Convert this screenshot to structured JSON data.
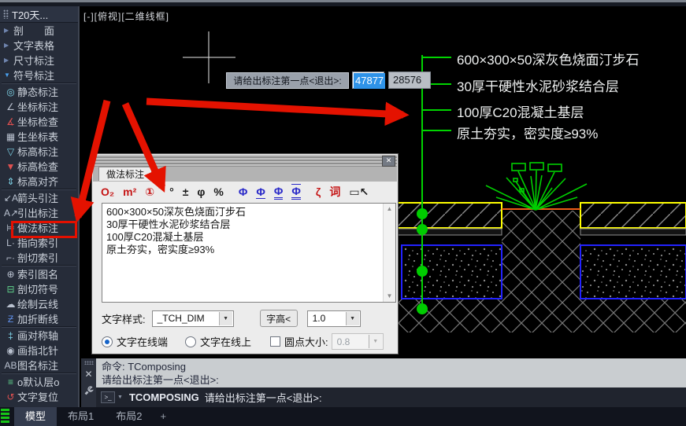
{
  "window": {
    "viewport_label": "[-][俯视][二维线框]"
  },
  "icons": {
    "chevron_right": "▶",
    "chevron_down": "▼",
    "close": "✕",
    "dropdown": "▼",
    "scroll_up": "▲",
    "scroll_down": "▼",
    "prompt": "&gt;_"
  },
  "sidebar": {
    "title": "T20天...",
    "items": [
      {
        "label": "剖　　面"
      },
      {
        "label": "文字表格"
      },
      {
        "label": "尺寸标注"
      },
      {
        "label": "符号标注"
      },
      {
        "label": "静态标注",
        "icon": "◎"
      },
      {
        "label": "坐标标注",
        "icon": "∠"
      },
      {
        "label": "坐标检查",
        "icon": "∡"
      },
      {
        "label": "生坐标表",
        "icon": "▦"
      },
      {
        "label": "标高标注",
        "icon": "▽"
      },
      {
        "label": "标高检查",
        "icon": "▼"
      },
      {
        "label": "标高对齐",
        "icon": "⇕"
      },
      {
        "label": "箭头引注",
        "icon": "↙A"
      },
      {
        "label": "引出标注",
        "icon": "A↗"
      },
      {
        "label": "做法标注",
        "icon": "⊨"
      },
      {
        "label": "指向索引",
        "icon": "L·"
      },
      {
        "label": "剖切索引",
        "icon": "⌐·"
      },
      {
        "label": "索引图名",
        "icon": "⊕"
      },
      {
        "label": "剖切符号",
        "icon": "⊟"
      },
      {
        "label": "绘制云线",
        "icon": "☁"
      },
      {
        "label": "加折断线",
        "icon": "Ƶ"
      },
      {
        "label": "画对称轴",
        "icon": "‡"
      },
      {
        "label": "画指北针",
        "icon": "◉"
      },
      {
        "label": "图名标注",
        "icon": "AB"
      },
      {
        "label": "o默认层o",
        "icon": "≡"
      },
      {
        "label": "文字复位",
        "icon": "↺"
      }
    ]
  },
  "drawing": {
    "annotations": [
      "600×300×50深灰色烧面汀步石",
      "30厚干硬性水泥砂浆结合层",
      "100厚C20混凝土基层",
      "原土夯实，密实度≥93%"
    ],
    "colors": {
      "leader_green": "#00d400",
      "paver_yellow": "#ffff00",
      "concrete_blue": "#2222ff",
      "soil_line_orange": "#ef5e18",
      "hatch_gray": "#8a8a8a",
      "text_white": "#eef0f0",
      "overlay_red": "#e41200"
    }
  },
  "dynamic_input": {
    "prompt": "请给出标注第一点<退出>:",
    "x_value": "47877",
    "y_value": "28576"
  },
  "dialog": {
    "tab": "做法标注",
    "toolbar": [
      "O₂",
      "m²",
      "①",
      "°",
      "±",
      "φ",
      "%",
      "Φ",
      "Φ",
      "Φ",
      "Φ",
      "ζ",
      "词",
      "▭↖"
    ],
    "lines": [
      "600×300×50深灰色烧面汀步石",
      "30厚干硬性水泥砂浆结合层",
      "100厚C20混凝土基层",
      "原土夯实，密实度≥93%"
    ],
    "text_style_label": "文字样式:",
    "text_style_value": "_TCH_DIM",
    "height_button": "字高<",
    "height_value": "1.0",
    "radio_text_at_end": "文字在线端",
    "radio_text_on_line": "文字在线上",
    "dot_size_label": "圆点大小:",
    "dot_size_value": "0.8"
  },
  "command": {
    "history": [
      "命令: TComposing",
      "请给出标注第一点<退出>:"
    ],
    "active_name": "TCOMPOSING",
    "active_prompt": "请给出标注第一点<退出>:"
  },
  "tabs": [
    {
      "label": "模型"
    },
    {
      "label": "布局1"
    },
    {
      "label": "布局2"
    },
    {
      "label": "+"
    }
  ]
}
